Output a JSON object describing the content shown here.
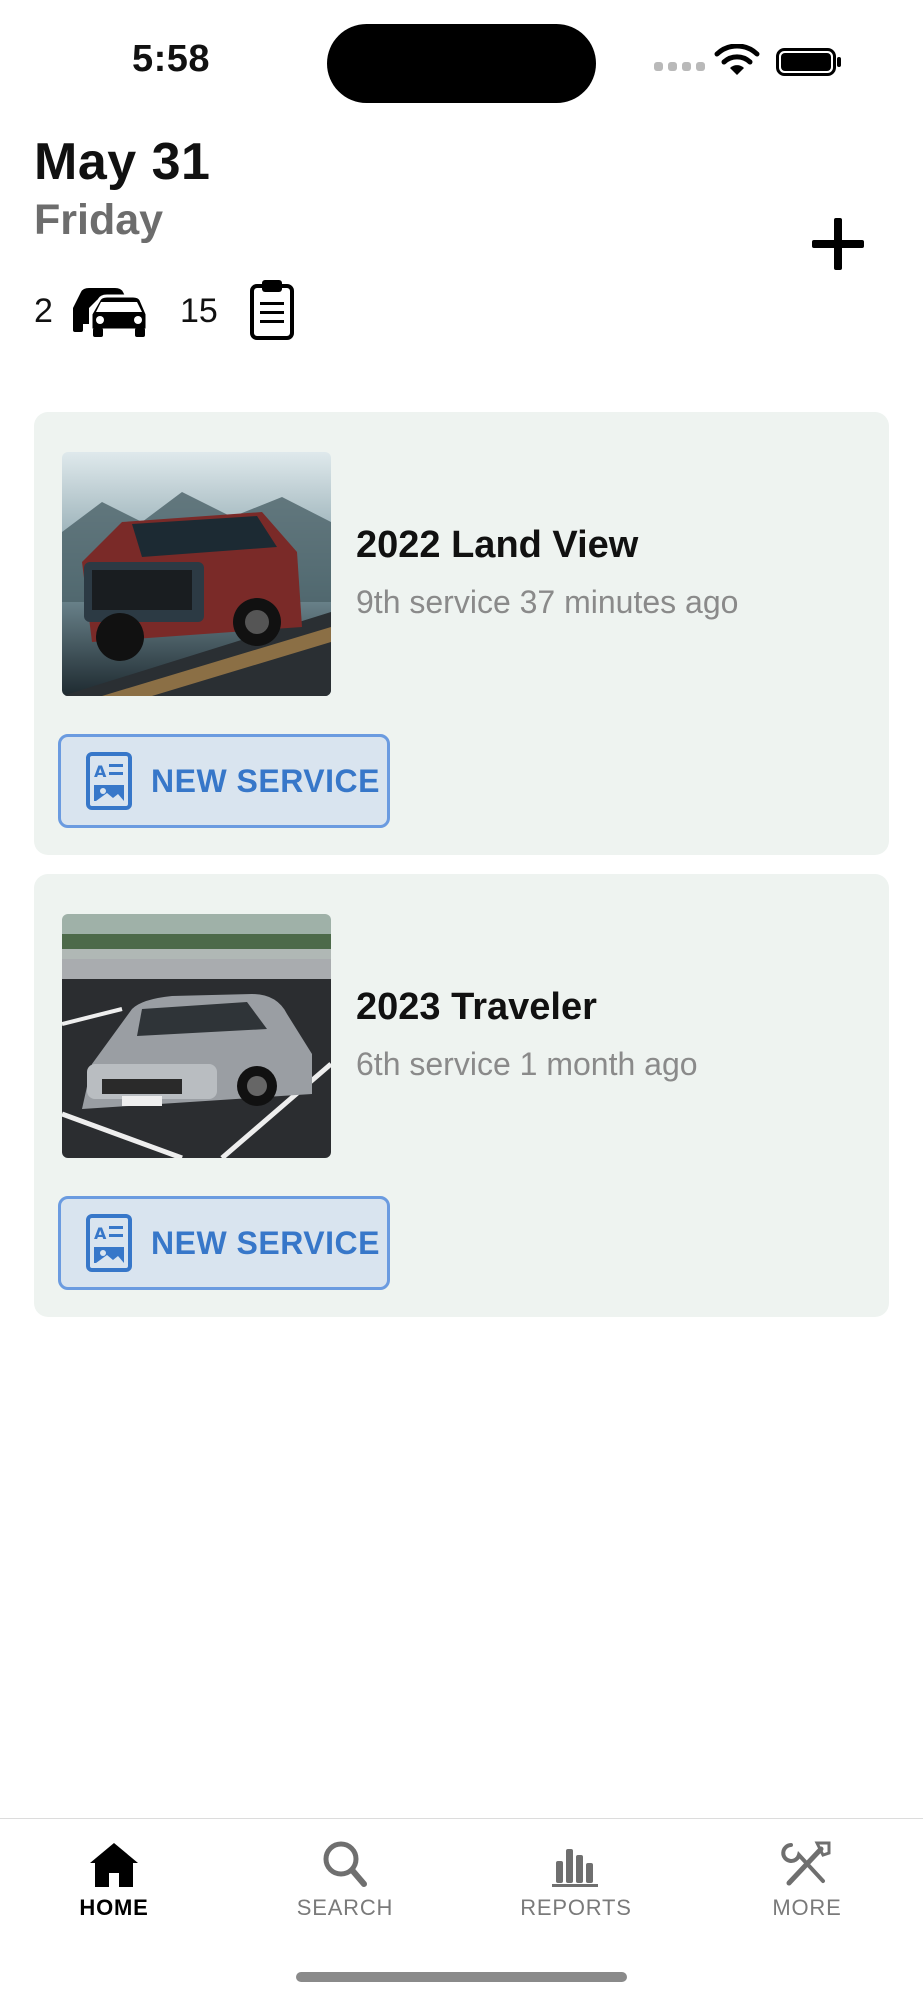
{
  "status_bar": {
    "time": "5:58"
  },
  "header": {
    "date": "May 31",
    "day": "Friday"
  },
  "stats": {
    "cars_count": "2",
    "services_count": "15"
  },
  "vehicles": [
    {
      "name": "2022 Land View",
      "subtitle": "9th service 37 minutes ago",
      "button_label": "NEW SERVICE"
    },
    {
      "name": "2023 Traveler",
      "subtitle": "6th service 1 month ago",
      "button_label": "NEW SERVICE"
    }
  ],
  "tab_bar": {
    "tabs": [
      {
        "label": "HOME",
        "icon": "home-icon",
        "active": true
      },
      {
        "label": "SEARCH",
        "icon": "search-icon",
        "active": false
      },
      {
        "label": "REPORTS",
        "icon": "bar-chart-icon",
        "active": false
      },
      {
        "label": "MORE",
        "icon": "tools-icon",
        "active": false
      }
    ]
  },
  "colors": {
    "accent": "#3777c9",
    "card_bg": "#eef3f0",
    "button_bg": "#d9e4ef",
    "button_border": "#6b9be0"
  }
}
